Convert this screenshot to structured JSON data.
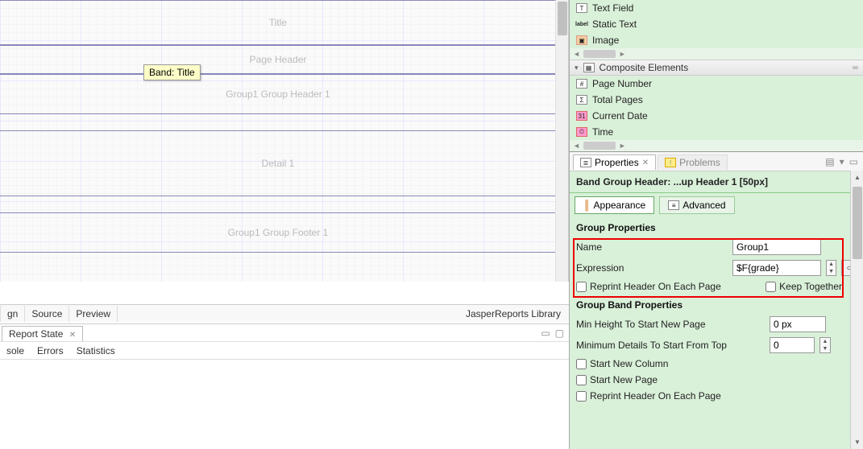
{
  "canvas": {
    "title_band": "Title",
    "page_header": "Page Header",
    "group_header": "Group1 Group Header 1",
    "detail": "Detail 1",
    "group_footer": "Group1 Group Footer 1",
    "tooltip": "Band: Title"
  },
  "editor_tabs": {
    "design": "gn",
    "source": "Source",
    "preview": "Preview",
    "library": "JasperReports Library"
  },
  "report_state": {
    "tab": "Report State",
    "console": "sole",
    "errors": "Errors",
    "statistics": "Statistics"
  },
  "palette": {
    "text_field": "Text Field",
    "static_text": "Static Text",
    "image": "Image",
    "composite_section": "Composite Elements",
    "page_number": "Page Number",
    "total_pages": "Total Pages",
    "current_date": "Current Date",
    "time": "Time"
  },
  "props": {
    "tab_properties": "Properties",
    "tab_problems": "Problems",
    "header": "Band Group Header: ...up Header 1 [50px]",
    "toggle_appearance": "Appearance",
    "toggle_advanced": "Advanced",
    "group_section": "Group Properties",
    "name_label": "Name",
    "name_value": "Group1",
    "expr_label": "Expression",
    "expr_value": "$F{grade}",
    "reprint_label": "Reprint Header On Each Page",
    "keep_label": "Keep Together",
    "band_section": "Group Band Properties",
    "minheight_label": "Min Height To Start New Page",
    "minheight_value": "0 px",
    "mindetails_label": "Minimum Details To Start From Top",
    "mindetails_value": "0",
    "newcol_label": "Start New Column",
    "newpage_label": "Start New Page",
    "reprint2_label": "Reprint Header On Each Page"
  }
}
